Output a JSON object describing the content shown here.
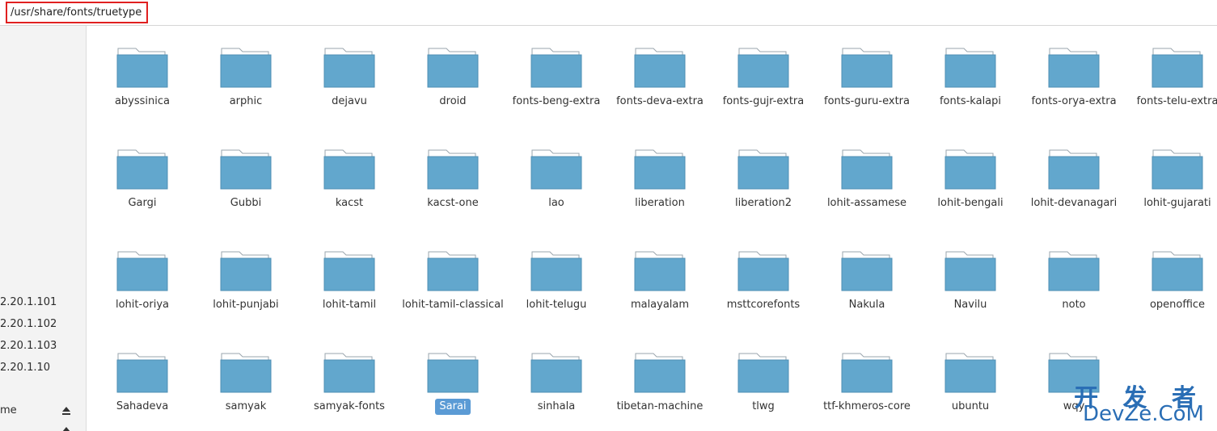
{
  "location": {
    "path": "/usr/share/fonts/truetype"
  },
  "sidebar": {
    "items": [
      {
        "label": "2.20.1.101"
      },
      {
        "label": "2.20.1.102"
      },
      {
        "label": "2.20.1.103"
      },
      {
        "label": "2.20.1.10"
      },
      {
        "label": "me",
        "icon": "eject-icon"
      }
    ]
  },
  "folders": [
    [
      "abyssinica",
      "arphic",
      "dejavu",
      "droid",
      "fonts-beng-extra",
      "fonts-deva-extra",
      "fonts-gujr-extra",
      "fonts-guru-extra",
      "fonts-kalapi",
      "fonts-orya-extra",
      "fonts-telu-extra"
    ],
    [
      "Gargi",
      "Gubbi",
      "kacst",
      "kacst-one",
      "lao",
      "liberation",
      "liberation2",
      "lohit-assamese",
      "lohit-bengali",
      "lohit-devanagari",
      "lohit-gujarati"
    ],
    [
      "lohit-oriya",
      "lohit-punjabi",
      "lohit-tamil",
      "lohit-tamil-classical",
      "lohit-telugu",
      "malayalam",
      "msttcorefonts",
      "Nakula",
      "Navilu",
      "noto",
      "openoffice"
    ],
    [
      "Sahadeva",
      "samyak",
      "samyak-fonts",
      "Sarai",
      "sinhala",
      "tibetan-machine",
      "tlwg",
      "ttf-khmeros-core",
      "ubuntu",
      "wqy"
    ]
  ],
  "selected_folder": "Sarai",
  "watermark": {
    "line1": "开 发 者",
    "line2": "DevZe.CoM"
  },
  "colors": {
    "folder_body": "#62a7cd",
    "folder_tab": "#ffffff",
    "selection": "#5b9bd5",
    "location_highlight": "#e02020",
    "watermark": "#2a6eb5"
  }
}
